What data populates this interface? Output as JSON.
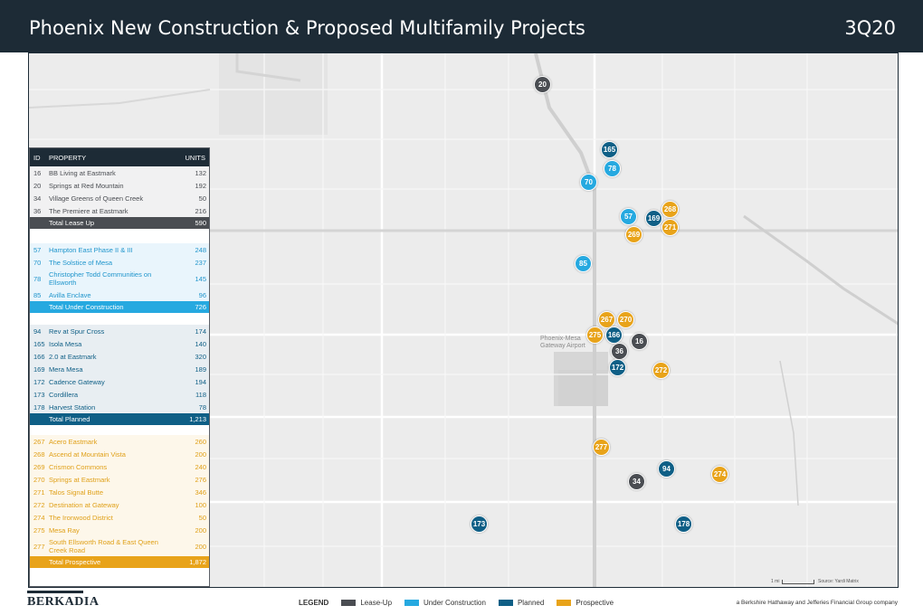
{
  "header": {
    "title": "Phoenix New Construction & Proposed Multifamily Projects",
    "quarter": "3Q20"
  },
  "table": {
    "col_id": "ID",
    "col_property": "PROPERTY",
    "col_units": "UNITS",
    "lease_up": [
      {
        "id": "16",
        "name": "BB Living at Eastmark",
        "units": "132"
      },
      {
        "id": "20",
        "name": "Springs at Red Mountain",
        "units": "192"
      },
      {
        "id": "34",
        "name": "Village Greens of  Queen Creek",
        "units": "50"
      },
      {
        "id": "36",
        "name": "The Premiere at Eastmark",
        "units": "216"
      }
    ],
    "lease_up_total": {
      "label": "Total Lease Up",
      "units": "590"
    },
    "under_construction": [
      {
        "id": "57",
        "name": "Hampton East Phase II & III",
        "units": "248"
      },
      {
        "id": "70",
        "name": "The Solstice of Mesa",
        "units": "237"
      },
      {
        "id": "78",
        "name": "Christopher Todd Communities on Ellsworth",
        "units": "145"
      },
      {
        "id": "85",
        "name": "Avilla Enclave",
        "units": "96"
      }
    ],
    "under_total": {
      "label": "Total Under Construction",
      "units": "726"
    },
    "planned": [
      {
        "id": "94",
        "name": "Rev at Spur Cross",
        "units": "174"
      },
      {
        "id": "165",
        "name": "Isola Mesa",
        "units": "140"
      },
      {
        "id": "166",
        "name": "2.0 at Eastmark",
        "units": "320"
      },
      {
        "id": "169",
        "name": "Mera Mesa",
        "units": "189"
      },
      {
        "id": "172",
        "name": "Cadence Gateway",
        "units": "194"
      },
      {
        "id": "173",
        "name": "Cordillera",
        "units": "118"
      },
      {
        "id": "178",
        "name": "Harvest Station",
        "units": "78"
      }
    ],
    "planned_total": {
      "label": "Total Planned",
      "units": "1,213"
    },
    "prospective": [
      {
        "id": "267",
        "name": "Acero Eastmark",
        "units": "260"
      },
      {
        "id": "268",
        "name": "Ascend at Mountain Vista",
        "units": "200"
      },
      {
        "id": "269",
        "name": "Crismon Commons",
        "units": "240"
      },
      {
        "id": "270",
        "name": "Springs at Eastmark",
        "units": "276"
      },
      {
        "id": "271",
        "name": "Talos Signal Butte",
        "units": "346"
      },
      {
        "id": "272",
        "name": "Destination at Gateway",
        "units": "100"
      },
      {
        "id": "274",
        "name": "The Ironwood District",
        "units": "50"
      },
      {
        "id": "275",
        "name": "Mesa Ray",
        "units": "200"
      },
      {
        "id": "277",
        "name": "South Ellsworth Road & East Queen Creek Road",
        "units": "200"
      }
    ],
    "prospect_total": {
      "label": "Total Prospective",
      "units": "1,872"
    }
  },
  "map": {
    "airport_label": "Phoenix-Mesa Gateway Airport",
    "colors": {
      "lease_up": "#4a4d52",
      "under_construction": "#26a9e0",
      "planned": "#0f5f86",
      "prospective": "#e8a31a"
    },
    "pins": [
      {
        "id": "20",
        "status": "lease_up"
      },
      {
        "id": "165",
        "status": "planned"
      },
      {
        "id": "78",
        "status": "under_construction"
      },
      {
        "id": "70",
        "status": "under_construction"
      },
      {
        "id": "268",
        "status": "prospective"
      },
      {
        "id": "57",
        "status": "under_construction"
      },
      {
        "id": "169",
        "status": "planned"
      },
      {
        "id": "271",
        "status": "prospective"
      },
      {
        "id": "269",
        "status": "prospective"
      },
      {
        "id": "85",
        "status": "under_construction"
      },
      {
        "id": "267",
        "status": "prospective"
      },
      {
        "id": "270",
        "status": "prospective"
      },
      {
        "id": "275",
        "status": "prospective"
      },
      {
        "id": "166",
        "status": "planned"
      },
      {
        "id": "16",
        "status": "lease_up"
      },
      {
        "id": "36",
        "status": "lease_up"
      },
      {
        "id": "172",
        "status": "planned"
      },
      {
        "id": "272",
        "status": "prospective"
      },
      {
        "id": "277",
        "status": "prospective"
      },
      {
        "id": "94",
        "status": "planned"
      },
      {
        "id": "274",
        "status": "prospective"
      },
      {
        "id": "34",
        "status": "lease_up"
      },
      {
        "id": "173",
        "status": "planned"
      },
      {
        "id": "178",
        "status": "planned"
      }
    ],
    "scale_label": "1 mi",
    "source": "Source: Yardi Matrix"
  },
  "footer": {
    "logo": "BERKADIA",
    "legend_label": "LEGEND",
    "legend": [
      "Lease-Up",
      "Under Construction",
      "Planned",
      "Prospective"
    ],
    "tagline": "a Berkshire Hathaway and Jefferies Financial Group company"
  }
}
